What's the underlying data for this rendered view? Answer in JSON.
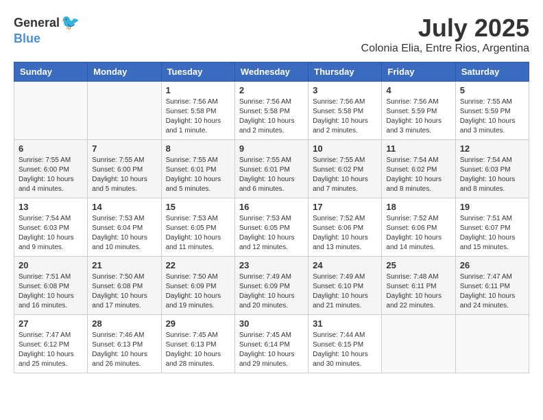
{
  "logo": {
    "general": "General",
    "blue": "Blue"
  },
  "header": {
    "title": "July 2025",
    "subtitle": "Colonia Elia, Entre Rios, Argentina"
  },
  "weekdays": [
    "Sunday",
    "Monday",
    "Tuesday",
    "Wednesday",
    "Thursday",
    "Friday",
    "Saturday"
  ],
  "weeks": [
    [
      {
        "day": "",
        "empty": true
      },
      {
        "day": "",
        "empty": true
      },
      {
        "day": "1",
        "sunrise": "Sunrise: 7:56 AM",
        "sunset": "Sunset: 5:58 PM",
        "daylight": "Daylight: 10 hours and 1 minute."
      },
      {
        "day": "2",
        "sunrise": "Sunrise: 7:56 AM",
        "sunset": "Sunset: 5:58 PM",
        "daylight": "Daylight: 10 hours and 2 minutes."
      },
      {
        "day": "3",
        "sunrise": "Sunrise: 7:56 AM",
        "sunset": "Sunset: 5:58 PM",
        "daylight": "Daylight: 10 hours and 2 minutes."
      },
      {
        "day": "4",
        "sunrise": "Sunrise: 7:56 AM",
        "sunset": "Sunset: 5:59 PM",
        "daylight": "Daylight: 10 hours and 3 minutes."
      },
      {
        "day": "5",
        "sunrise": "Sunrise: 7:55 AM",
        "sunset": "Sunset: 5:59 PM",
        "daylight": "Daylight: 10 hours and 3 minutes."
      }
    ],
    [
      {
        "day": "6",
        "sunrise": "Sunrise: 7:55 AM",
        "sunset": "Sunset: 6:00 PM",
        "daylight": "Daylight: 10 hours and 4 minutes."
      },
      {
        "day": "7",
        "sunrise": "Sunrise: 7:55 AM",
        "sunset": "Sunset: 6:00 PM",
        "daylight": "Daylight: 10 hours and 5 minutes."
      },
      {
        "day": "8",
        "sunrise": "Sunrise: 7:55 AM",
        "sunset": "Sunset: 6:01 PM",
        "daylight": "Daylight: 10 hours and 5 minutes."
      },
      {
        "day": "9",
        "sunrise": "Sunrise: 7:55 AM",
        "sunset": "Sunset: 6:01 PM",
        "daylight": "Daylight: 10 hours and 6 minutes."
      },
      {
        "day": "10",
        "sunrise": "Sunrise: 7:55 AM",
        "sunset": "Sunset: 6:02 PM",
        "daylight": "Daylight: 10 hours and 7 minutes."
      },
      {
        "day": "11",
        "sunrise": "Sunrise: 7:54 AM",
        "sunset": "Sunset: 6:02 PM",
        "daylight": "Daylight: 10 hours and 8 minutes."
      },
      {
        "day": "12",
        "sunrise": "Sunrise: 7:54 AM",
        "sunset": "Sunset: 6:03 PM",
        "daylight": "Daylight: 10 hours and 8 minutes."
      }
    ],
    [
      {
        "day": "13",
        "sunrise": "Sunrise: 7:54 AM",
        "sunset": "Sunset: 6:03 PM",
        "daylight": "Daylight: 10 hours and 9 minutes."
      },
      {
        "day": "14",
        "sunrise": "Sunrise: 7:53 AM",
        "sunset": "Sunset: 6:04 PM",
        "daylight": "Daylight: 10 hours and 10 minutes."
      },
      {
        "day": "15",
        "sunrise": "Sunrise: 7:53 AM",
        "sunset": "Sunset: 6:05 PM",
        "daylight": "Daylight: 10 hours and 11 minutes."
      },
      {
        "day": "16",
        "sunrise": "Sunrise: 7:53 AM",
        "sunset": "Sunset: 6:05 PM",
        "daylight": "Daylight: 10 hours and 12 minutes."
      },
      {
        "day": "17",
        "sunrise": "Sunrise: 7:52 AM",
        "sunset": "Sunset: 6:06 PM",
        "daylight": "Daylight: 10 hours and 13 minutes."
      },
      {
        "day": "18",
        "sunrise": "Sunrise: 7:52 AM",
        "sunset": "Sunset: 6:06 PM",
        "daylight": "Daylight: 10 hours and 14 minutes."
      },
      {
        "day": "19",
        "sunrise": "Sunrise: 7:51 AM",
        "sunset": "Sunset: 6:07 PM",
        "daylight": "Daylight: 10 hours and 15 minutes."
      }
    ],
    [
      {
        "day": "20",
        "sunrise": "Sunrise: 7:51 AM",
        "sunset": "Sunset: 6:08 PM",
        "daylight": "Daylight: 10 hours and 16 minutes."
      },
      {
        "day": "21",
        "sunrise": "Sunrise: 7:50 AM",
        "sunset": "Sunset: 6:08 PM",
        "daylight": "Daylight: 10 hours and 17 minutes."
      },
      {
        "day": "22",
        "sunrise": "Sunrise: 7:50 AM",
        "sunset": "Sunset: 6:09 PM",
        "daylight": "Daylight: 10 hours and 19 minutes."
      },
      {
        "day": "23",
        "sunrise": "Sunrise: 7:49 AM",
        "sunset": "Sunset: 6:09 PM",
        "daylight": "Daylight: 10 hours and 20 minutes."
      },
      {
        "day": "24",
        "sunrise": "Sunrise: 7:49 AM",
        "sunset": "Sunset: 6:10 PM",
        "daylight": "Daylight: 10 hours and 21 minutes."
      },
      {
        "day": "25",
        "sunrise": "Sunrise: 7:48 AM",
        "sunset": "Sunset: 6:11 PM",
        "daylight": "Daylight: 10 hours and 22 minutes."
      },
      {
        "day": "26",
        "sunrise": "Sunrise: 7:47 AM",
        "sunset": "Sunset: 6:11 PM",
        "daylight": "Daylight: 10 hours and 24 minutes."
      }
    ],
    [
      {
        "day": "27",
        "sunrise": "Sunrise: 7:47 AM",
        "sunset": "Sunset: 6:12 PM",
        "daylight": "Daylight: 10 hours and 25 minutes."
      },
      {
        "day": "28",
        "sunrise": "Sunrise: 7:46 AM",
        "sunset": "Sunset: 6:13 PM",
        "daylight": "Daylight: 10 hours and 26 minutes."
      },
      {
        "day": "29",
        "sunrise": "Sunrise: 7:45 AM",
        "sunset": "Sunset: 6:13 PM",
        "daylight": "Daylight: 10 hours and 28 minutes."
      },
      {
        "day": "30",
        "sunrise": "Sunrise: 7:45 AM",
        "sunset": "Sunset: 6:14 PM",
        "daylight": "Daylight: 10 hours and 29 minutes."
      },
      {
        "day": "31",
        "sunrise": "Sunrise: 7:44 AM",
        "sunset": "Sunset: 6:15 PM",
        "daylight": "Daylight: 10 hours and 30 minutes."
      },
      {
        "day": "",
        "empty": true
      },
      {
        "day": "",
        "empty": true
      }
    ]
  ]
}
